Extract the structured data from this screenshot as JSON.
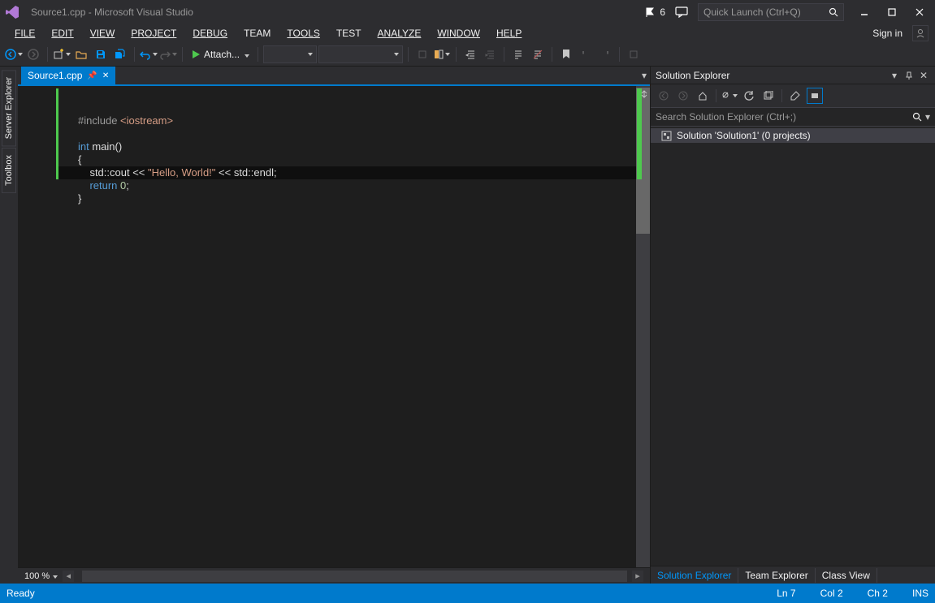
{
  "titlebar": {
    "title": "Source1.cpp - Microsoft Visual Studio",
    "notification_count": "6",
    "quick_launch_placeholder": "Quick Launch (Ctrl+Q)"
  },
  "menu": {
    "file": "FILE",
    "edit": "EDIT",
    "view": "VIEW",
    "project": "PROJECT",
    "debug": "DEBUG",
    "team": "TEAM",
    "tools": "TOOLS",
    "test": "TEST",
    "analyze": "ANALYZE",
    "window": "WINDOW",
    "help": "HELP",
    "signin": "Sign in"
  },
  "toolbar": {
    "attach_label": "Attach..."
  },
  "side_tabs": {
    "server_explorer": "Server Explorer",
    "toolbox": "Toolbox"
  },
  "doc_tab": {
    "filename": "Source1.cpp"
  },
  "code": {
    "line1_pp": "#include ",
    "line1_inc": "<iostream>",
    "line3_kw": "int",
    "line3_rest": " main()",
    "line4": "{",
    "line5_pre": "    std::cout << ",
    "line5_str": "\"Hello, World!\"",
    "line5_post": " << std::endl;",
    "line6_pre": "    ",
    "line6_kw": "return",
    "line6_post": " ",
    "line6_num": "0",
    "line6_semi": ";",
    "line7": "}"
  },
  "editor_footer": {
    "zoom": "100 %"
  },
  "solution_explorer": {
    "title": "Solution Explorer",
    "search_placeholder": "Search Solution Explorer (Ctrl+;)",
    "root": "Solution 'Solution1' (0 projects)"
  },
  "panel_tabs": {
    "solution_explorer": "Solution Explorer",
    "team_explorer": "Team Explorer",
    "class_view": "Class View"
  },
  "statusbar": {
    "ready": "Ready",
    "line": "Ln 7",
    "col": "Col 2",
    "ch": "Ch 2",
    "ins": "INS"
  }
}
